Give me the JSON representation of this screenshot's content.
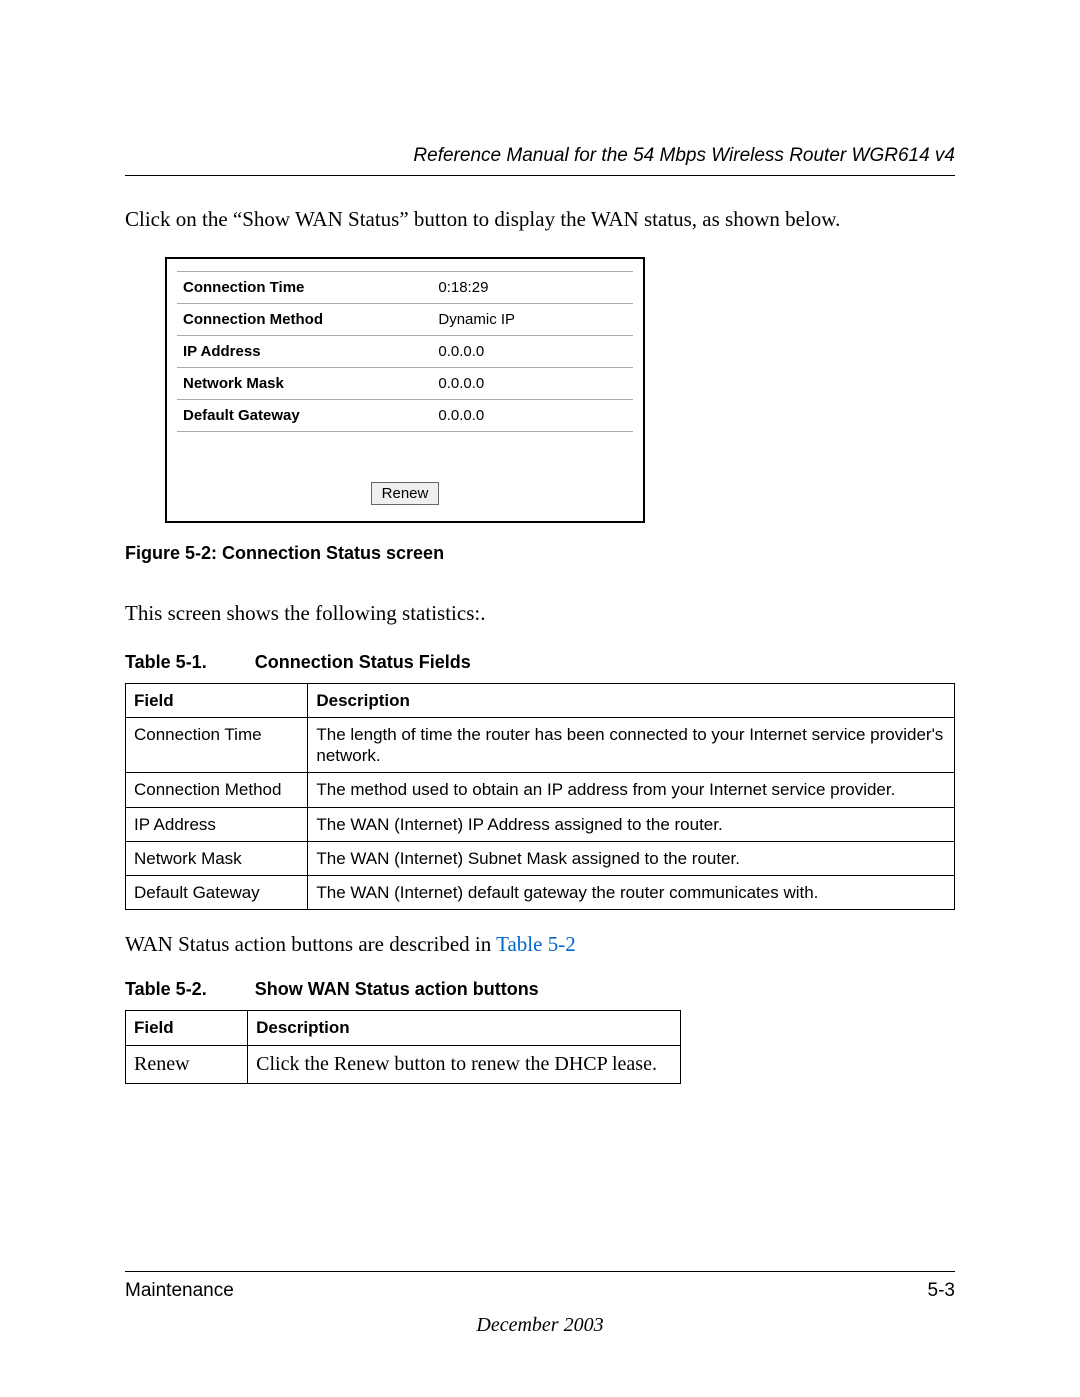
{
  "header": "Reference Manual for the 54 Mbps Wireless Router WGR614 v4",
  "intro": "Click on the “Show WAN Status” button to display the WAN status, as shown below.",
  "screenshot": {
    "rows": [
      {
        "label": "Connection Time",
        "value": "0:18:29"
      },
      {
        "label": "Connection Method",
        "value": "Dynamic IP"
      },
      {
        "label": "IP Address",
        "value": "0.0.0.0"
      },
      {
        "label": "Network Mask",
        "value": "0.0.0.0"
      },
      {
        "label": "Default Gateway",
        "value": "0.0.0.0"
      }
    ],
    "button": "Renew"
  },
  "figure_caption": "Figure 5-2:  Connection Status screen",
  "after_figure": "This screen shows the following statistics:.",
  "table1_caption_a": "Table 5-1.",
  "table1_caption_b": "Connection Status Fields",
  "table1": {
    "head": {
      "field": "Field",
      "desc": "Description"
    },
    "rows": [
      {
        "field": "Connection Time",
        "desc": "The length of time the router has been connected to your Internet service provider's network."
      },
      {
        "field": "Connection Method",
        "desc": "The method used to obtain an IP address from your Internet service provider."
      },
      {
        "field": "IP Address",
        "desc": "The WAN (Internet) IP Address assigned to the router."
      },
      {
        "field": "Network Mask",
        "desc": "The WAN (Internet) Subnet Mask assigned to the router."
      },
      {
        "field": "Default Gateway",
        "desc": "The WAN (Internet) default gateway the router communicates with."
      }
    ]
  },
  "xref_pre": "WAN Status action buttons are described in ",
  "xref_link": "Table 5-2",
  "table2_caption_a": "Table 5-2.",
  "table2_caption_b": "Show WAN Status action buttons",
  "table2": {
    "head": {
      "field": "Field",
      "desc": "Description"
    },
    "rows": [
      {
        "field": "Renew",
        "desc": "Click the Renew button to renew the DHCP lease."
      }
    ]
  },
  "footer": {
    "section": "Maintenance",
    "page": "5-3",
    "date": "December 2003"
  }
}
